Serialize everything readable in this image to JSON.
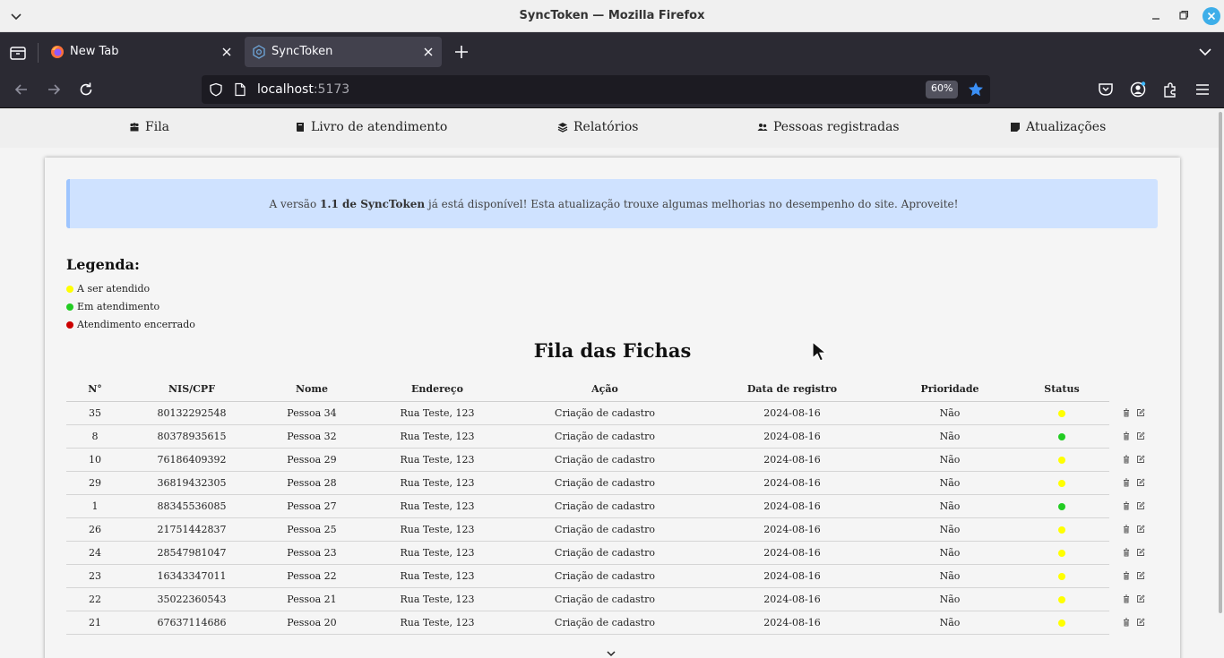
{
  "window": {
    "title": "SyncToken — Mozilla Firefox"
  },
  "tabs": [
    {
      "label": "New Tab",
      "favicon": "firefox-icon"
    },
    {
      "label": "SyncToken",
      "favicon": "synctoken-icon",
      "active": true
    }
  ],
  "urlbar": {
    "host": "localhost",
    "port": ":5173",
    "zoom": "60%"
  },
  "nav": {
    "items": [
      {
        "label": "Fila",
        "icon": "people-group-icon"
      },
      {
        "label": "Livro de atendimento",
        "icon": "book-icon"
      },
      {
        "label": "Relatórios",
        "icon": "layers-icon"
      },
      {
        "label": "Pessoas registradas",
        "icon": "users-icon"
      },
      {
        "label": "Atualizações",
        "icon": "note-icon"
      }
    ]
  },
  "alert": {
    "prefix": "A versão ",
    "version": "1.1 de SyncToken",
    "suffix": " já está disponível! Esta atualização trouxe algumas melhorias no desempenho do site. Aproveite!"
  },
  "legend": {
    "title": "Legenda:",
    "items": [
      {
        "label": "A ser atendido",
        "color": "#ffff00"
      },
      {
        "label": "Em atendimento",
        "color": "#22cc22"
      },
      {
        "label": "Atendimento encerrado",
        "color": "#cc0000"
      }
    ]
  },
  "queue": {
    "title": "Fila das Fichas",
    "columns": [
      "N°",
      "NIS/CPF",
      "Nome",
      "Endereço",
      "Ação",
      "Data de registro",
      "Prioridade",
      "Status"
    ],
    "status_colors": {
      "waiting": "#ffff00",
      "in_service": "#22cc22",
      "closed": "#cc0000"
    },
    "rows": [
      {
        "n": "35",
        "nis": "80132292548",
        "nome": "Pessoa 34",
        "endereco": "Rua Teste, 123",
        "acao": "Criação de cadastro",
        "data": "2024-08-16",
        "prioridade": "Não",
        "status": "waiting"
      },
      {
        "n": "8",
        "nis": "80378935615",
        "nome": "Pessoa 32",
        "endereco": "Rua Teste, 123",
        "acao": "Criação de cadastro",
        "data": "2024-08-16",
        "prioridade": "Não",
        "status": "in_service"
      },
      {
        "n": "10",
        "nis": "76186409392",
        "nome": "Pessoa 29",
        "endereco": "Rua Teste, 123",
        "acao": "Criação de cadastro",
        "data": "2024-08-16",
        "prioridade": "Não",
        "status": "waiting"
      },
      {
        "n": "29",
        "nis": "36819432305",
        "nome": "Pessoa 28",
        "endereco": "Rua Teste, 123",
        "acao": "Criação de cadastro",
        "data": "2024-08-16",
        "prioridade": "Não",
        "status": "waiting"
      },
      {
        "n": "1",
        "nis": "88345536085",
        "nome": "Pessoa 27",
        "endereco": "Rua Teste, 123",
        "acao": "Criação de cadastro",
        "data": "2024-08-16",
        "prioridade": "Não",
        "status": "in_service"
      },
      {
        "n": "26",
        "nis": "21751442837",
        "nome": "Pessoa 25",
        "endereco": "Rua Teste, 123",
        "acao": "Criação de cadastro",
        "data": "2024-08-16",
        "prioridade": "Não",
        "status": "waiting"
      },
      {
        "n": "24",
        "nis": "28547981047",
        "nome": "Pessoa 23",
        "endereco": "Rua Teste, 123",
        "acao": "Criação de cadastro",
        "data": "2024-08-16",
        "prioridade": "Não",
        "status": "waiting"
      },
      {
        "n": "23",
        "nis": "16343347011",
        "nome": "Pessoa 22",
        "endereco": "Rua Teste, 123",
        "acao": "Criação de cadastro",
        "data": "2024-08-16",
        "prioridade": "Não",
        "status": "waiting"
      },
      {
        "n": "22",
        "nis": "35022360543",
        "nome": "Pessoa 21",
        "endereco": "Rua Teste, 123",
        "acao": "Criação de cadastro",
        "data": "2024-08-16",
        "prioridade": "Não",
        "status": "waiting"
      },
      {
        "n": "21",
        "nis": "67637114686",
        "nome": "Pessoa 20",
        "endereco": "Rua Teste, 123",
        "acao": "Criação de cadastro",
        "data": "2024-08-16",
        "prioridade": "Não",
        "status": "waiting"
      }
    ]
  }
}
